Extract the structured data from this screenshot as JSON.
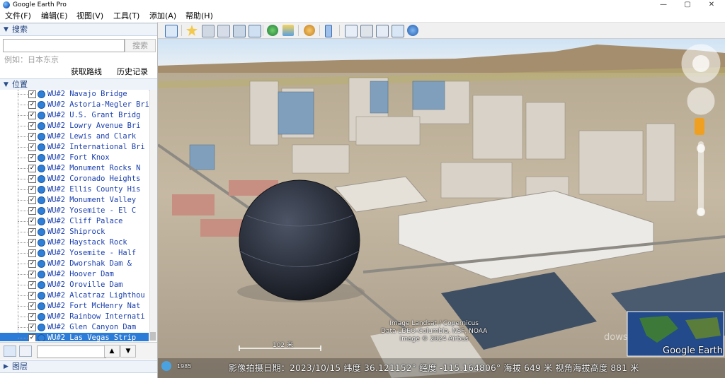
{
  "window": {
    "title": "Google Earth Pro",
    "controls": [
      "—",
      "▢",
      "✕"
    ]
  },
  "menu": [
    "文件(F)",
    "编辑(E)",
    "视图(V)",
    "工具(T)",
    "添加(A)",
    "帮助(H)"
  ],
  "search": {
    "section_label": "搜索",
    "placeholder": "",
    "button_label": "搜索",
    "hint": "例如：日本东京",
    "route_link": "获取路线",
    "history_link": "历史记录"
  },
  "places": {
    "section_label": "位置",
    "items": [
      "WU#2 Navajo Bridge",
      "WU#2 Astoria-Megler Bri",
      "WU#2 U.S. Grant Bridg",
      "WU#2 Lowry Avenue Bri",
      "WU#2 Lewis and Clark",
      "WU#2 International Bri",
      "WU#2 Fort Knox",
      "WU#2 Monument Rocks N",
      "WU#2 Coronado Heights",
      "WU#2 Ellis County His",
      "WU#2 Monument Valley",
      "WU#2 Yosemite - El C",
      "WU#2 Cliff Palace",
      "WU#2 Shiprock",
      "WU#2 Haystack Rock",
      "WU#2 Yosemite - Half",
      "WU#2 Dworshak Dam &",
      "WU#2 Hoover Dam",
      "WU#2 Oroville Dam",
      "WU#2 Alcatraz Lighthou",
      "WU#2 Fort McHenry Nat",
      "WU#2 Rainbow Internati",
      "WU#2 Glen Canyon Dam",
      "WU#2 Las Vegas Strip"
    ],
    "selected_index": 23
  },
  "layers": {
    "section_label": "图层"
  },
  "list_toolbar": {
    "up": "▲",
    "down": "▼"
  },
  "map": {
    "attribution": [
      "Image Landsat / Copernicus",
      "Data LDEO-Columbia, NSF, NOAA",
      "Image © 2024 Airbus"
    ],
    "scale": "102 米",
    "year": "1985",
    "logo": "Google Earth",
    "watermark": "dows",
    "status": "影像拍摄日期：2023/10/15   纬度   36.121152°  经度 -115.164806°  海拔   649 米  视角海拔高度   881 米"
  },
  "colors": {
    "selection": "#2b7bd8",
    "link_text": "#1a3fae",
    "section_bg": "#eef3fa"
  }
}
